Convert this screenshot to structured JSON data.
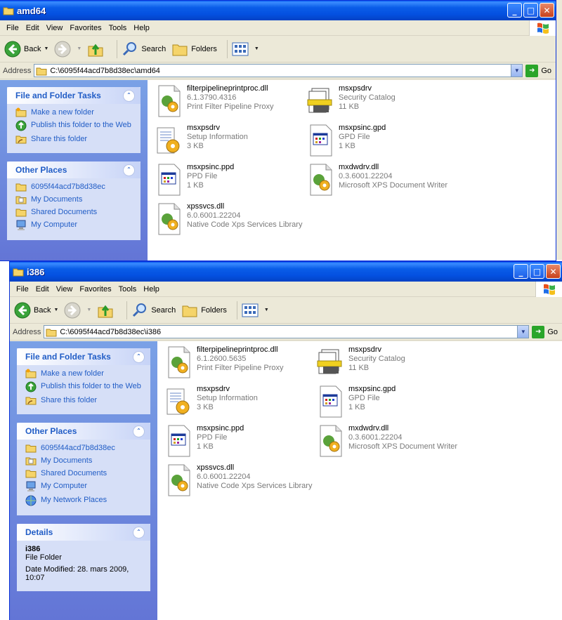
{
  "menu": [
    "File",
    "Edit",
    "View",
    "Favorites",
    "Tools",
    "Help"
  ],
  "toolbar": {
    "back": "Back",
    "search": "Search",
    "folders": "Folders"
  },
  "address_label": "Address",
  "go_label": "Go",
  "panels": {
    "file_tasks": {
      "title": "File and Folder Tasks",
      "items": [
        "Make a new folder",
        "Publish this folder to the Web",
        "Share this folder"
      ]
    },
    "other_places_title": "Other Places",
    "details": {
      "title": "Details",
      "name": "i386",
      "type": "File Folder",
      "modified": "Date Modified: 28. mars 2009, 10:07"
    }
  },
  "windows": {
    "amd64": {
      "title": "amd64",
      "address": "C:\\6095f44acd7b8d38ec\\amd64",
      "other_places": [
        "6095f44acd7b8d38ec",
        "My Documents",
        "Shared Documents",
        "My Computer"
      ],
      "files": [
        {
          "name": "filterpipelineprintproc.dll",
          "l2": "6.1.3790.4316",
          "l3": "Print Filter Pipeline Proxy",
          "icon": "dll-icon"
        },
        {
          "name": "msxpsdrv",
          "l2": "Security Catalog",
          "l3": "11 KB",
          "icon": "catalog-icon"
        },
        {
          "name": "msxpsdrv",
          "l2": "Setup Information",
          "l3": "3 KB",
          "icon": "setup-info-icon"
        },
        {
          "name": "msxpsinc.gpd",
          "l2": "GPD File",
          "l3": "1 KB",
          "icon": "gpd-file-icon"
        },
        {
          "name": "msxpsinc.ppd",
          "l2": "PPD File",
          "l3": "1 KB",
          "icon": "ppd-file-icon"
        },
        {
          "name": "mxdwdrv.dll",
          "l2": "0.3.6001.22204",
          "l3": "Microsoft XPS Document Writer",
          "icon": "dll-icon"
        },
        {
          "name": "xpssvcs.dll",
          "l2": "6.0.6001.22204",
          "l3": "Native Code Xps Services Library",
          "icon": "dll-icon"
        }
      ]
    },
    "i386": {
      "title": "i386",
      "address": "C:\\6095f44acd7b8d38ec\\i386",
      "other_places": [
        "6095f44acd7b8d38ec",
        "My Documents",
        "Shared Documents",
        "My Computer",
        "My Network Places"
      ],
      "files": [
        {
          "name": "filterpipelineprintproc.dll",
          "l2": "6.1.2600.5635",
          "l3": "Print Filter Pipeline Proxy",
          "icon": "dll-icon"
        },
        {
          "name": "msxpsdrv",
          "l2": "Security Catalog",
          "l3": "11 KB",
          "icon": "catalog-icon"
        },
        {
          "name": "msxpsdrv",
          "l2": "Setup Information",
          "l3": "3 KB",
          "icon": "setup-info-icon"
        },
        {
          "name": "msxpsinc.gpd",
          "l2": "GPD File",
          "l3": "1 KB",
          "icon": "gpd-file-icon"
        },
        {
          "name": "msxpsinc.ppd",
          "l2": "PPD File",
          "l3": "1 KB",
          "icon": "ppd-file-icon"
        },
        {
          "name": "mxdwdrv.dll",
          "l2": "0.3.6001.22204",
          "l3": "Microsoft XPS Document Writer",
          "icon": "dll-icon"
        },
        {
          "name": "xpssvcs.dll",
          "l2": "6.0.6001.22204",
          "l3": "Native Code Xps Services Library",
          "icon": "dll-icon"
        }
      ]
    }
  }
}
